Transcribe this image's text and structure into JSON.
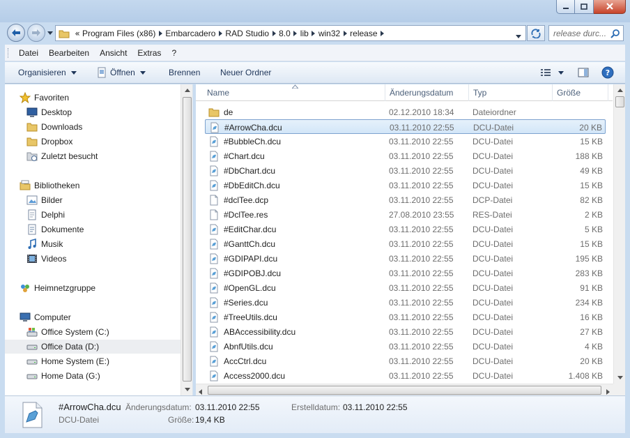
{
  "window": {
    "controls": {
      "minimize": "minimize",
      "maximize": "maximize",
      "close": "close"
    }
  },
  "address": {
    "segments": [
      "Program Files (x86)",
      "Embarcadero",
      "RAD Studio",
      "8.0",
      "lib",
      "win32",
      "release"
    ],
    "search_placeholder": "release durc..."
  },
  "menu": {
    "items": [
      "Datei",
      "Bearbeiten",
      "Ansicht",
      "Extras",
      "?"
    ]
  },
  "toolbar": {
    "organize": "Organisieren",
    "open": "Öffnen",
    "burn": "Brennen",
    "new_folder": "Neuer Ordner"
  },
  "sidebar": {
    "items": [
      {
        "label": "Favoriten",
        "icon": "star-icon",
        "level": 0,
        "y": 0
      },
      {
        "label": "Desktop",
        "icon": "desktop-icon",
        "level": 1
      },
      {
        "label": "Downloads",
        "icon": "folder-icon",
        "level": 1
      },
      {
        "label": "Dropbox",
        "icon": "folder-icon",
        "level": 1
      },
      {
        "label": "Zuletzt besucht",
        "icon": "recent-places-icon",
        "level": 1
      },
      {
        "label": "Bibliotheken",
        "icon": "library-icon",
        "level": 0
      },
      {
        "label": "Bilder",
        "icon": "pictures-icon",
        "level": 1
      },
      {
        "label": "Delphi",
        "icon": "library-doc-icon",
        "level": 1
      },
      {
        "label": "Dokumente",
        "icon": "documents-icon",
        "level": 1
      },
      {
        "label": "Musik",
        "icon": "music-icon",
        "level": 1
      },
      {
        "label": "Videos",
        "icon": "video-icon",
        "level": 1
      },
      {
        "label": "Heimnetzgruppe",
        "icon": "homegroup-icon",
        "level": 0
      },
      {
        "label": "Computer",
        "icon": "computer-icon",
        "level": 0
      },
      {
        "label": "Office System (C:)",
        "icon": "system-drive-icon",
        "level": 1
      },
      {
        "label": "Office Data (D:)",
        "icon": "drive-icon",
        "level": 1,
        "selected": true
      },
      {
        "label": "Home System (E:)",
        "icon": "drive-icon",
        "level": 1
      },
      {
        "label": "Home Data (G:)",
        "icon": "drive-icon",
        "level": 1
      }
    ]
  },
  "columns": {
    "name": "Name",
    "date": "Änderungsdatum",
    "type": "Typ",
    "size": "Größe"
  },
  "files": [
    {
      "name": "de",
      "date": "02.12.2010 18:34",
      "type": "Dateiordner",
      "size": "",
      "icon": "folder-icon"
    },
    {
      "name": "#ArrowCha.dcu",
      "date": "03.11.2010 22:55",
      "type": "DCU-Datei",
      "size": "20 KB",
      "icon": "file-icon",
      "selected": true
    },
    {
      "name": "#BubbleCh.dcu",
      "date": "03.11.2010 22:55",
      "type": "DCU-Datei",
      "size": "15 KB",
      "icon": "file-icon"
    },
    {
      "name": "#Chart.dcu",
      "date": "03.11.2010 22:55",
      "type": "DCU-Datei",
      "size": "188 KB",
      "icon": "file-icon"
    },
    {
      "name": "#DbChart.dcu",
      "date": "03.11.2010 22:55",
      "type": "DCU-Datei",
      "size": "49 KB",
      "icon": "file-icon"
    },
    {
      "name": "#DbEditCh.dcu",
      "date": "03.11.2010 22:55",
      "type": "DCU-Datei",
      "size": "15 KB",
      "icon": "file-icon"
    },
    {
      "name": "#dclTee.dcp",
      "date": "03.11.2010 22:55",
      "type": "DCP-Datei",
      "size": "82 KB",
      "icon": "blank-file-icon"
    },
    {
      "name": "#DclTee.res",
      "date": "27.08.2010 23:55",
      "type": "RES-Datei",
      "size": "2 KB",
      "icon": "blank-file-icon"
    },
    {
      "name": "#EditChar.dcu",
      "date": "03.11.2010 22:55",
      "type": "DCU-Datei",
      "size": "5 KB",
      "icon": "file-icon"
    },
    {
      "name": "#GanttCh.dcu",
      "date": "03.11.2010 22:55",
      "type": "DCU-Datei",
      "size": "15 KB",
      "icon": "file-icon"
    },
    {
      "name": "#GDIPAPI.dcu",
      "date": "03.11.2010 22:55",
      "type": "DCU-Datei",
      "size": "195 KB",
      "icon": "file-icon"
    },
    {
      "name": "#GDIPOBJ.dcu",
      "date": "03.11.2010 22:55",
      "type": "DCU-Datei",
      "size": "283 KB",
      "icon": "file-icon"
    },
    {
      "name": "#OpenGL.dcu",
      "date": "03.11.2010 22:55",
      "type": "DCU-Datei",
      "size": "91 KB",
      "icon": "file-icon"
    },
    {
      "name": "#Series.dcu",
      "date": "03.11.2010 22:55",
      "type": "DCU-Datei",
      "size": "234 KB",
      "icon": "file-icon"
    },
    {
      "name": "#TreeUtils.dcu",
      "date": "03.11.2010 22:55",
      "type": "DCU-Datei",
      "size": "16 KB",
      "icon": "file-icon"
    },
    {
      "name": "ABAccessibility.dcu",
      "date": "03.11.2010 22:55",
      "type": "DCU-Datei",
      "size": "27 KB",
      "icon": "file-icon"
    },
    {
      "name": "AbnfUtils.dcu",
      "date": "03.11.2010 22:55",
      "type": "DCU-Datei",
      "size": "4 KB",
      "icon": "file-icon"
    },
    {
      "name": "AccCtrl.dcu",
      "date": "03.11.2010 22:55",
      "type": "DCU-Datei",
      "size": "20 KB",
      "icon": "file-icon"
    },
    {
      "name": "Access2000.dcu",
      "date": "03.11.2010 22:55",
      "type": "DCU-Datei",
      "size": "1.408 KB",
      "icon": "file-icon"
    }
  ],
  "details": {
    "filename": "#ArrowCha.dcu",
    "filetype": "DCU-Datei",
    "modified_label": "Änderungsdatum:",
    "modified_value": "03.11.2010 22:55",
    "created_label": "Erstelldatum:",
    "created_value": "03.11.2010 22:55",
    "size_label": "Größe:",
    "size_value": "19,4 KB"
  },
  "colors": {
    "selection": "#d3e6f8",
    "selection_border": "#7da2ce",
    "frame": "#c9dcf0"
  }
}
